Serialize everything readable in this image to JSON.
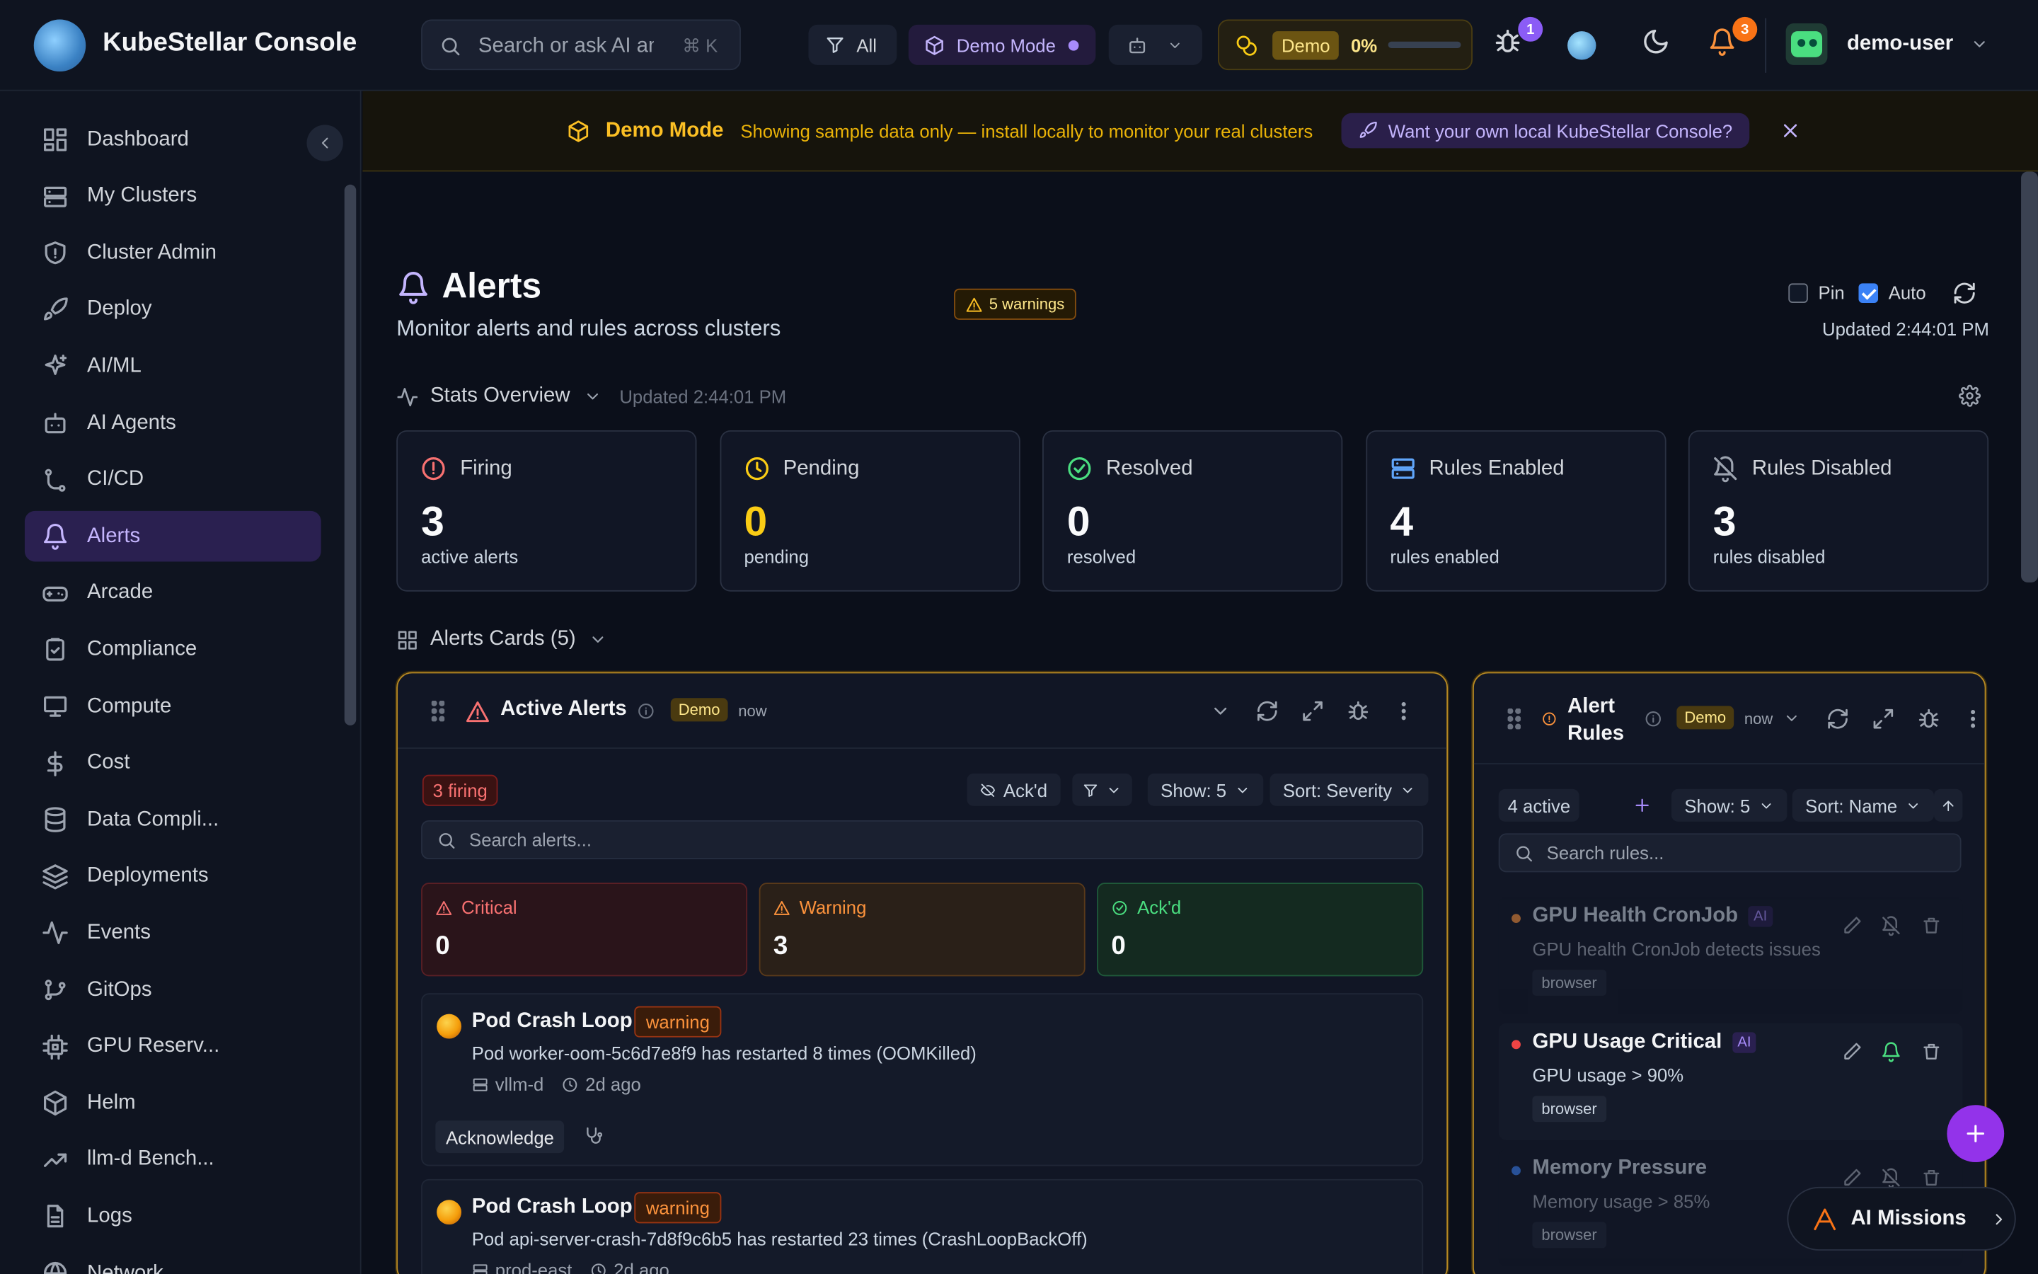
{
  "app": {
    "title": "KubeStellar Console"
  },
  "topbar": {
    "search_placeholder": "Search or ask AI anything",
    "search_shortcut": "⌘ K",
    "filter_label": "All",
    "demo_mode_label": "Demo Mode",
    "tokens_badge": "Demo",
    "tokens_percent": "0%",
    "bug_count": "1",
    "notif_count": "3",
    "user_name": "demo-user"
  },
  "sidebar": {
    "items": [
      {
        "label": "Dashboard",
        "icon": "grid-icon"
      },
      {
        "label": "My Clusters",
        "icon": "server-icon"
      },
      {
        "label": "Cluster Admin",
        "icon": "shield-icon"
      },
      {
        "label": "Deploy",
        "icon": "rocket-icon"
      },
      {
        "label": "AI/ML",
        "icon": "sparkles-icon"
      },
      {
        "label": "AI Agents",
        "icon": "bot-icon"
      },
      {
        "label": "CI/CD",
        "icon": "git-branch-icon"
      },
      {
        "label": "Alerts",
        "icon": "bell-icon"
      },
      {
        "label": "Arcade",
        "icon": "gamepad-icon"
      },
      {
        "label": "Compliance",
        "icon": "clipboard-icon"
      },
      {
        "label": "Compute",
        "icon": "monitor-icon"
      },
      {
        "label": "Cost",
        "icon": "dollar-icon"
      },
      {
        "label": "Data Compli...",
        "icon": "database-icon"
      },
      {
        "label": "Deployments",
        "icon": "layers-icon"
      },
      {
        "label": "Events",
        "icon": "activity-icon"
      },
      {
        "label": "GitOps",
        "icon": "git-icon"
      },
      {
        "label": "GPU Reserv...",
        "icon": "cpu-icon"
      },
      {
        "label": "Helm",
        "icon": "package-icon"
      },
      {
        "label": "llm-d Bench...",
        "icon": "trending-icon"
      },
      {
        "label": "Logs",
        "icon": "file-icon"
      },
      {
        "label": "Network",
        "icon": "globe-icon"
      }
    ]
  },
  "banner": {
    "title": "Demo Mode",
    "subtitle": "Showing sample data only — install locally to monitor your real clusters",
    "cta": "Want your own local KubeStellar Console?"
  },
  "page": {
    "title": "Alerts",
    "subtitle": "Monitor alerts and rules across clusters",
    "warnings": "5 warnings",
    "pin_label": "Pin",
    "auto_label": "Auto",
    "updated": "Updated 2:44:01 PM"
  },
  "stats": {
    "header": "Stats Overview",
    "updated": "Updated 2:44:01 PM",
    "cards": [
      {
        "title": "Firing",
        "value": "3",
        "label": "active alerts",
        "color": "#f87171"
      },
      {
        "title": "Pending",
        "value": "0",
        "label": "pending",
        "color": "#facc15"
      },
      {
        "title": "Resolved",
        "value": "0",
        "label": "resolved",
        "color": "#4ade80"
      },
      {
        "title": "Rules Enabled",
        "value": "4",
        "label": "rules enabled",
        "color": "#60a5fa"
      },
      {
        "title": "Rules Disabled",
        "value": "3",
        "label": "rules disabled",
        "color": "#9ca3af"
      }
    ]
  },
  "cards_section": {
    "title": "Alerts Cards (5)"
  },
  "active_alerts": {
    "title": "Active Alerts",
    "demo": "Demo",
    "time": "now",
    "firing": "3 firing",
    "ackd_filter": "Ack'd",
    "show": "Show: 5",
    "sort": "Sort: Severity",
    "search_placeholder": "Search alerts...",
    "severities": [
      {
        "label": "Critical",
        "value": "0"
      },
      {
        "label": "Warning",
        "value": "3"
      },
      {
        "label": "Ack'd",
        "value": "0"
      }
    ],
    "alerts": [
      {
        "title": "Pod Crash Loop",
        "severity": "warning",
        "desc": "Pod worker-oom-5c6d7e8f9 has restarted 8 times (OOMKilled)",
        "cluster": "vllm-d",
        "age": "2d ago",
        "action": "Acknowledge"
      },
      {
        "title": "Pod Crash Loop",
        "severity": "warning",
        "desc": "Pod api-server-crash-7d8f9c6b5 has restarted 23 times (CrashLoopBackOff)",
        "cluster": "prod-east",
        "age": "2d ago"
      }
    ]
  },
  "alert_rules": {
    "title_line1": "Alert",
    "title_line2": "Rules",
    "demo": "Demo",
    "time": "now",
    "active": "4 active",
    "show": "Show: 5",
    "sort": "Sort: Name",
    "search_placeholder": "Search rules...",
    "rules": [
      {
        "name": "GPU Health CronJob",
        "ai": "AI",
        "desc": "GPU health CronJob detects issues",
        "tag": "browser"
      },
      {
        "name": "GPU Usage Critical",
        "ai": "AI",
        "desc": "GPU usage > 90%",
        "tag": "browser"
      },
      {
        "name": "Memory Pressure",
        "desc": "Memory usage > 85%",
        "tag": "browser"
      }
    ]
  },
  "missions": {
    "label": "AI Missions"
  }
}
